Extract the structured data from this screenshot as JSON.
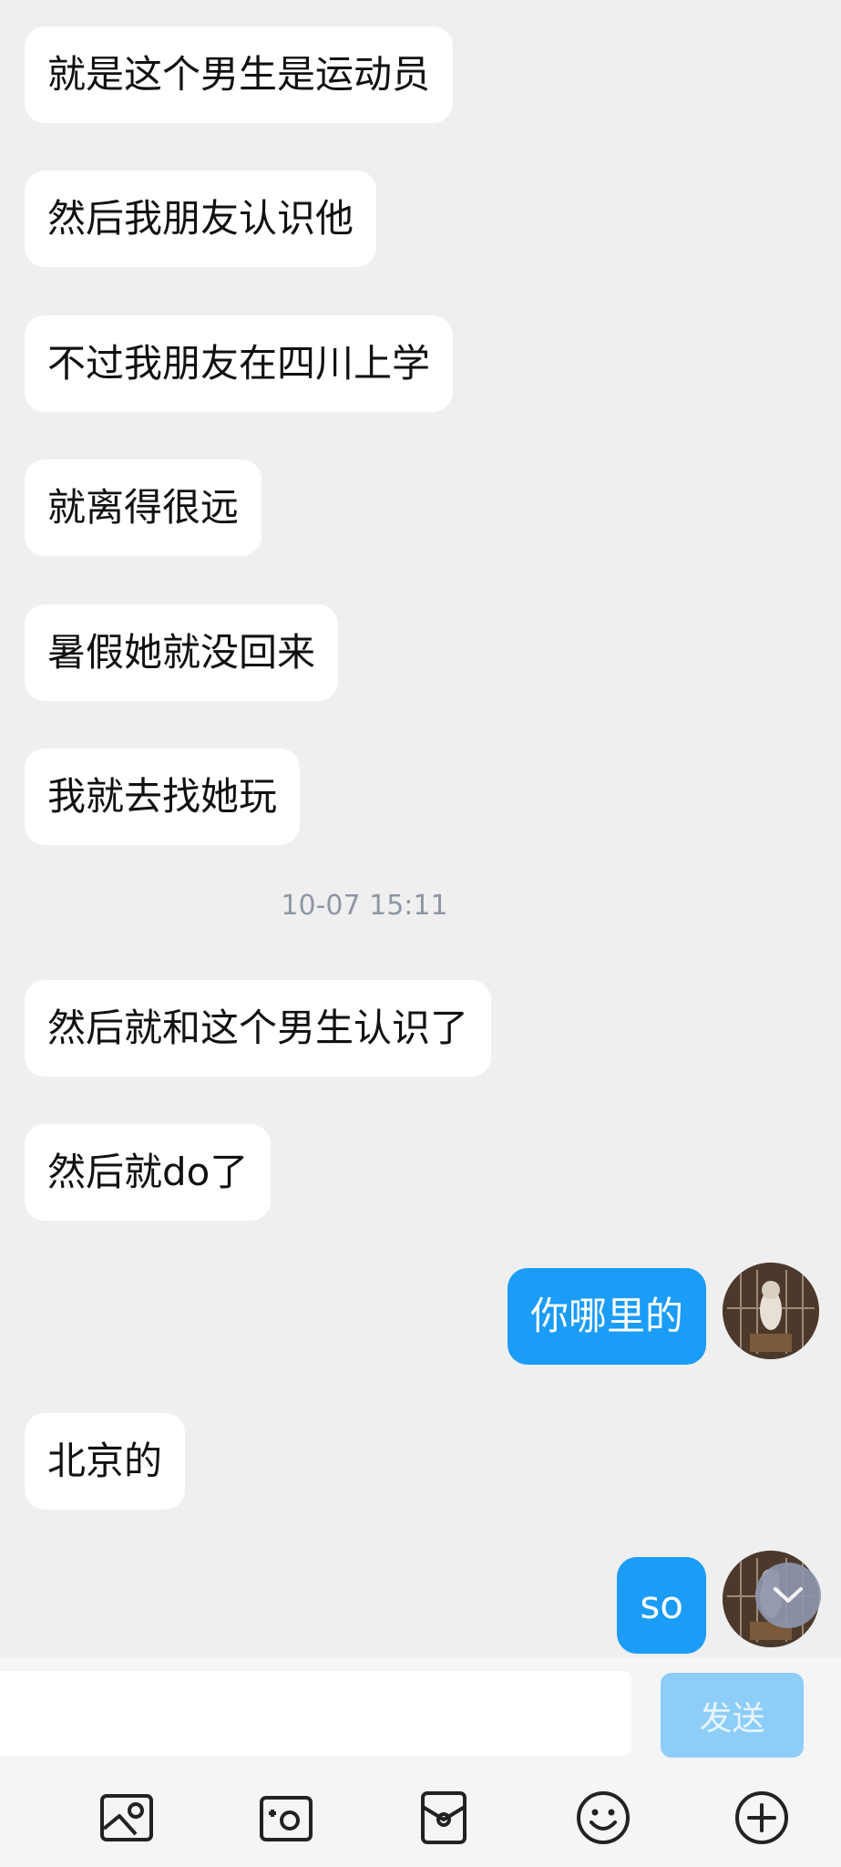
{
  "messages": [
    {
      "side": "in",
      "text": "就是这个男生是运动员"
    },
    {
      "side": "in",
      "text": "然后我朋友认识他"
    },
    {
      "side": "in",
      "text": "不过我朋友在四川上学"
    },
    {
      "side": "in",
      "text": "就离得很远"
    },
    {
      "side": "in",
      "text": "暑假她就没回来"
    },
    {
      "side": "in",
      "text": "我就去找她玩"
    },
    {
      "side": "in",
      "text": "然后就和这个男生认识了"
    },
    {
      "side": "in",
      "text": "然后就do了"
    },
    {
      "side": "out",
      "text": "你哪里的"
    },
    {
      "side": "in",
      "text": "北京的"
    },
    {
      "side": "out",
      "text": "so"
    }
  ],
  "timestamp": "10-07 15:11",
  "input": {
    "value": "",
    "placeholder": ""
  },
  "send_label": "发送",
  "toolbar": [
    "image-icon",
    "camera-icon",
    "red-packet-icon",
    "emoji-icon",
    "plus-icon"
  ],
  "colors": {
    "outgoing_bubble": "#1a9cf7",
    "send_button_disabled": "#8ecdf8",
    "background": "#efefef"
  }
}
